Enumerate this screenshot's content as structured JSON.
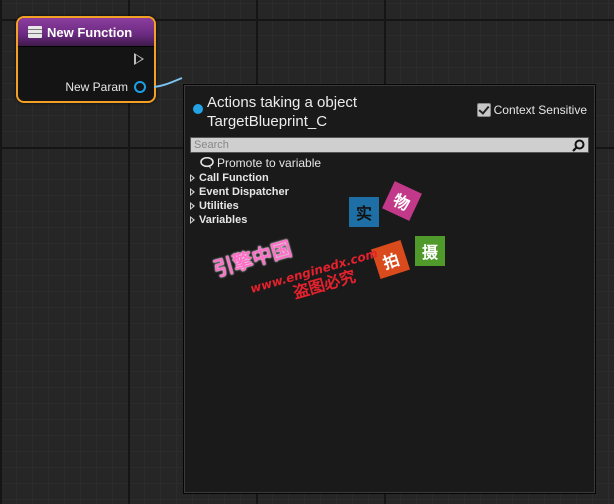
{
  "node": {
    "title": "New Function",
    "param_label": "New Param",
    "colors": {
      "border": "#f3a025",
      "header": "#8c3d9e",
      "pin": "#1aa0e8"
    }
  },
  "menu": {
    "context_title": "Actions taking a object TargetBlueprint_C",
    "context_sensitive_label": "Context Sensitive",
    "context_sensitive_checked": true,
    "search_placeholder": "Search",
    "search_value": "",
    "promote_label": "Promote to variable",
    "categories": [
      {
        "label": "Call Function"
      },
      {
        "label": "Event Dispatcher"
      },
      {
        "label": "Utilities"
      },
      {
        "label": "Variables"
      }
    ]
  },
  "watermark": {
    "boxes": [
      "实",
      "物",
      "拍",
      "摄"
    ],
    "brand": "引擎中国",
    "url": "www.enginedx.com",
    "notice": "盗图必究"
  }
}
